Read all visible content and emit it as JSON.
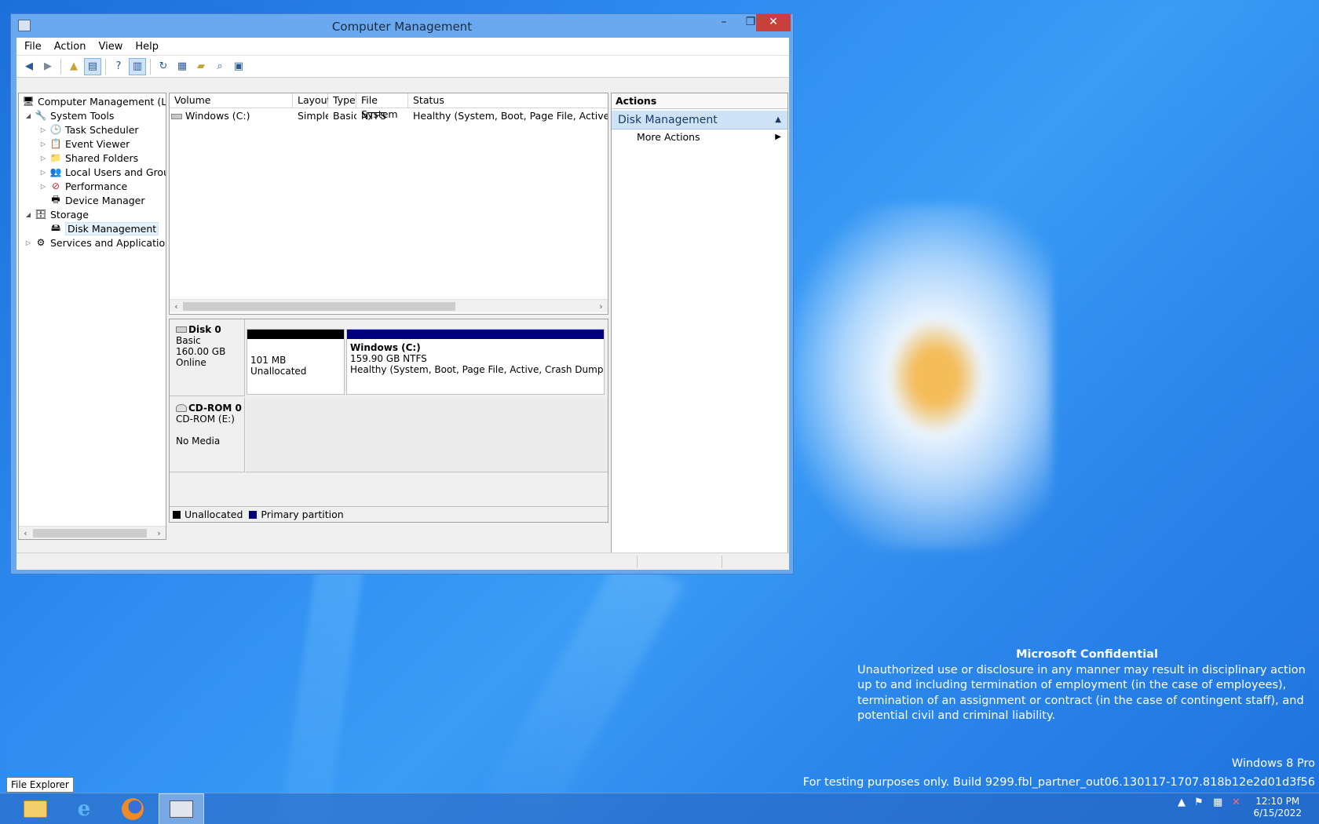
{
  "window": {
    "title": "Computer Management",
    "minimize": "–",
    "maximize": "❐",
    "close": "✕"
  },
  "menu": [
    "File",
    "Action",
    "View",
    "Help"
  ],
  "tree": [
    {
      "label": "Computer Management (Local",
      "icon": "computer-management-icon"
    },
    {
      "label": "System Tools",
      "icon": "tools-icon"
    },
    {
      "label": "Task Scheduler",
      "icon": "clock-icon"
    },
    {
      "label": "Event Viewer",
      "icon": "event-viewer-icon"
    },
    {
      "label": "Shared Folders",
      "icon": "shared-folder-icon"
    },
    {
      "label": "Local Users and Groups",
      "icon": "users-icon"
    },
    {
      "label": "Performance",
      "icon": "performance-icon"
    },
    {
      "label": "Device Manager",
      "icon": "device-manager-icon"
    },
    {
      "label": "Storage",
      "icon": "storage-icon"
    },
    {
      "label": "Disk Management",
      "icon": "disk-icon"
    },
    {
      "label": "Services and Applications",
      "icon": "services-icon"
    }
  ],
  "volumes": {
    "headers": [
      "Volume",
      "Layout",
      "Type",
      "File System",
      "Status"
    ],
    "rows": [
      [
        "Windows (C:)",
        "Simple",
        "Basic",
        "NTFS",
        "Healthy (System, Boot, Page File, Active, Crash Du"
      ]
    ]
  },
  "disks": {
    "disk0": {
      "name": "Disk 0",
      "type": "Basic",
      "size": "160.00 GB",
      "state": "Online",
      "partitions": [
        {
          "size": "101 MB",
          "desc": "Unallocated"
        },
        {
          "title": "Windows  (C:)",
          "size": "159.90 GB NTFS",
          "desc": "Healthy (System, Boot, Page File, Active, Crash Dump, Primary P"
        }
      ]
    },
    "cdrom0": {
      "name": "CD-ROM 0",
      "drive": "CD-ROM (E:)",
      "media": "No Media"
    },
    "legend": {
      "unallocated": "Unallocated",
      "primary": "Primary partition",
      "unallocated_color": "#000000",
      "primary_color": "#00007f"
    }
  },
  "actions": {
    "header": "Actions",
    "section": "Disk Management",
    "more": "More Actions"
  },
  "desktop": {
    "confidential_title": "Microsoft Confidential",
    "confidential_body": "Unauthorized use or disclosure in any manner may result in disciplinary action up to and including termination of employment (in the case of employees), termination of an assignment or contract (in the case of contingent staff), and potential civil and criminal liability.",
    "edition": "Windows 8 Pro",
    "build": "For testing purposes only. Build 9299.fbl_partner_out06.130117-1707.818b12e2d01d3f56"
  },
  "taskbar": {
    "tooltip": "File Explorer",
    "apps": [
      "file-explorer-icon",
      "internet-explorer-icon",
      "firefox-icon",
      "computer-management-icon"
    ],
    "time": "12:10 PM",
    "date": "6/15/2022"
  }
}
